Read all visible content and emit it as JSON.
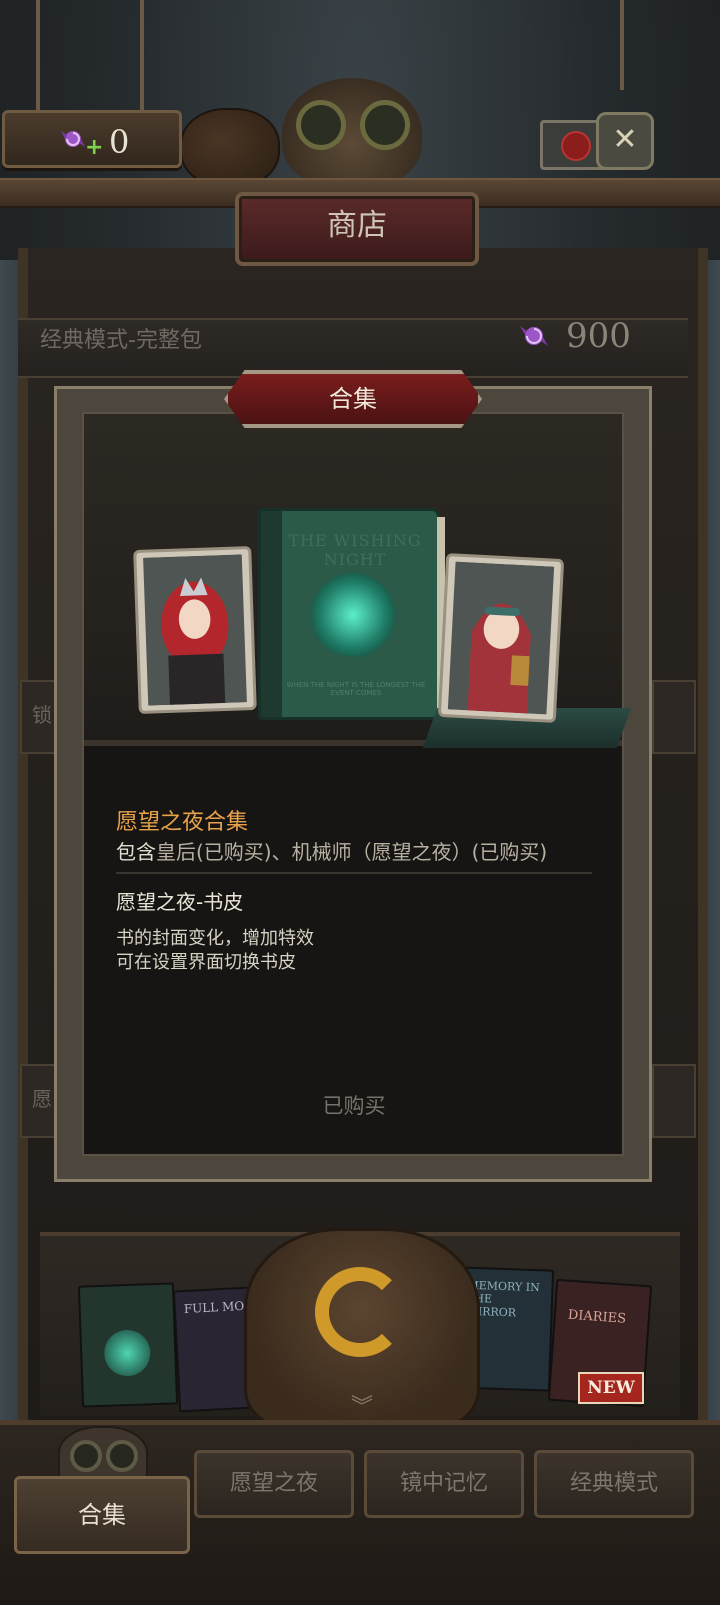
{
  "header": {
    "candy_count": "0",
    "plus_symbol": "+",
    "title": "商店",
    "close_symbol": "✕"
  },
  "pack": {
    "name": "经典模式-完整包",
    "price": "900"
  },
  "side_tabs": {
    "left_1": "锁",
    "left_2": "愿"
  },
  "modal": {
    "title": "合集",
    "book_title": "THE WISHING NIGHT",
    "book_subtitle": "WHEN THE NIGHT IS THE LONGEST THE EVENT COMES",
    "bundle_name": "愿望之夜合集",
    "contents_lead": "包含",
    "contents_rest": "皇后(已购买)、机械师（愿望之夜）(已购买)",
    "skin_name": "愿望之夜-书皮",
    "skin_desc_line1": "书的封面变化，增加特效",
    "skin_desc_line2": "可在设置界面切换书皮",
    "status": "已购买"
  },
  "shelf_books": {
    "book1": "THE WISHING NIGHT",
    "book2": "FULL MOON",
    "book3": "MEMORY IN THE MIRROR",
    "book4": "DIARIES",
    "new_badge": "NEW"
  },
  "nav": {
    "tab1": "合集",
    "tab2": "愿望之夜",
    "tab3": "镜中记忆",
    "tab4": "经典模式"
  },
  "colors": {
    "accent_orange": "#e8a24a",
    "title_red": "#7a1d1d",
    "candy_purple": "#8e4bb3"
  }
}
